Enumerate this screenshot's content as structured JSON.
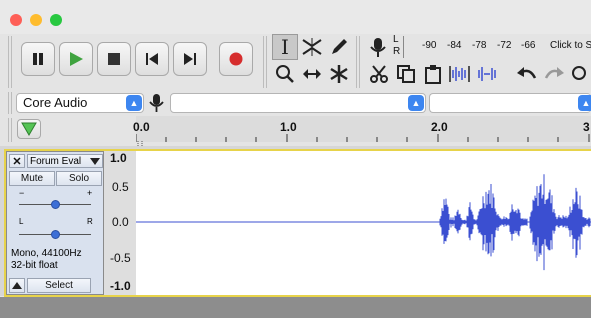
{
  "toolbar": {
    "meter_rec_label": "R",
    "meter_play_label": "L",
    "meter_ticks": [
      "-90",
      "-84",
      "-78",
      "-72",
      "-66"
    ],
    "meter_hint": "Click to S"
  },
  "device": {
    "host": "Core Audio",
    "recording_device": "",
    "playback_device": ""
  },
  "timeline": {
    "ticks": [
      "0.0",
      "1.0",
      "2.0",
      "3"
    ]
  },
  "track": {
    "name": "Forum Eval",
    "mute_label": "Mute",
    "solo_label": "Solo",
    "gain_minus": "−",
    "gain_plus": "+",
    "pan_left": "L",
    "pan_right": "R",
    "info_line1": "Mono, 44100Hz",
    "info_line2": "32-bit float",
    "select_label": "Select",
    "scale": [
      "1.0",
      "0.5",
      "0.0",
      "-0.5",
      "-1.0"
    ]
  },
  "colors": {
    "waveform": "#3b4fd1",
    "selection_border": "#e7d34a",
    "record": "#d62d2d",
    "play": "#3fa33f"
  }
}
